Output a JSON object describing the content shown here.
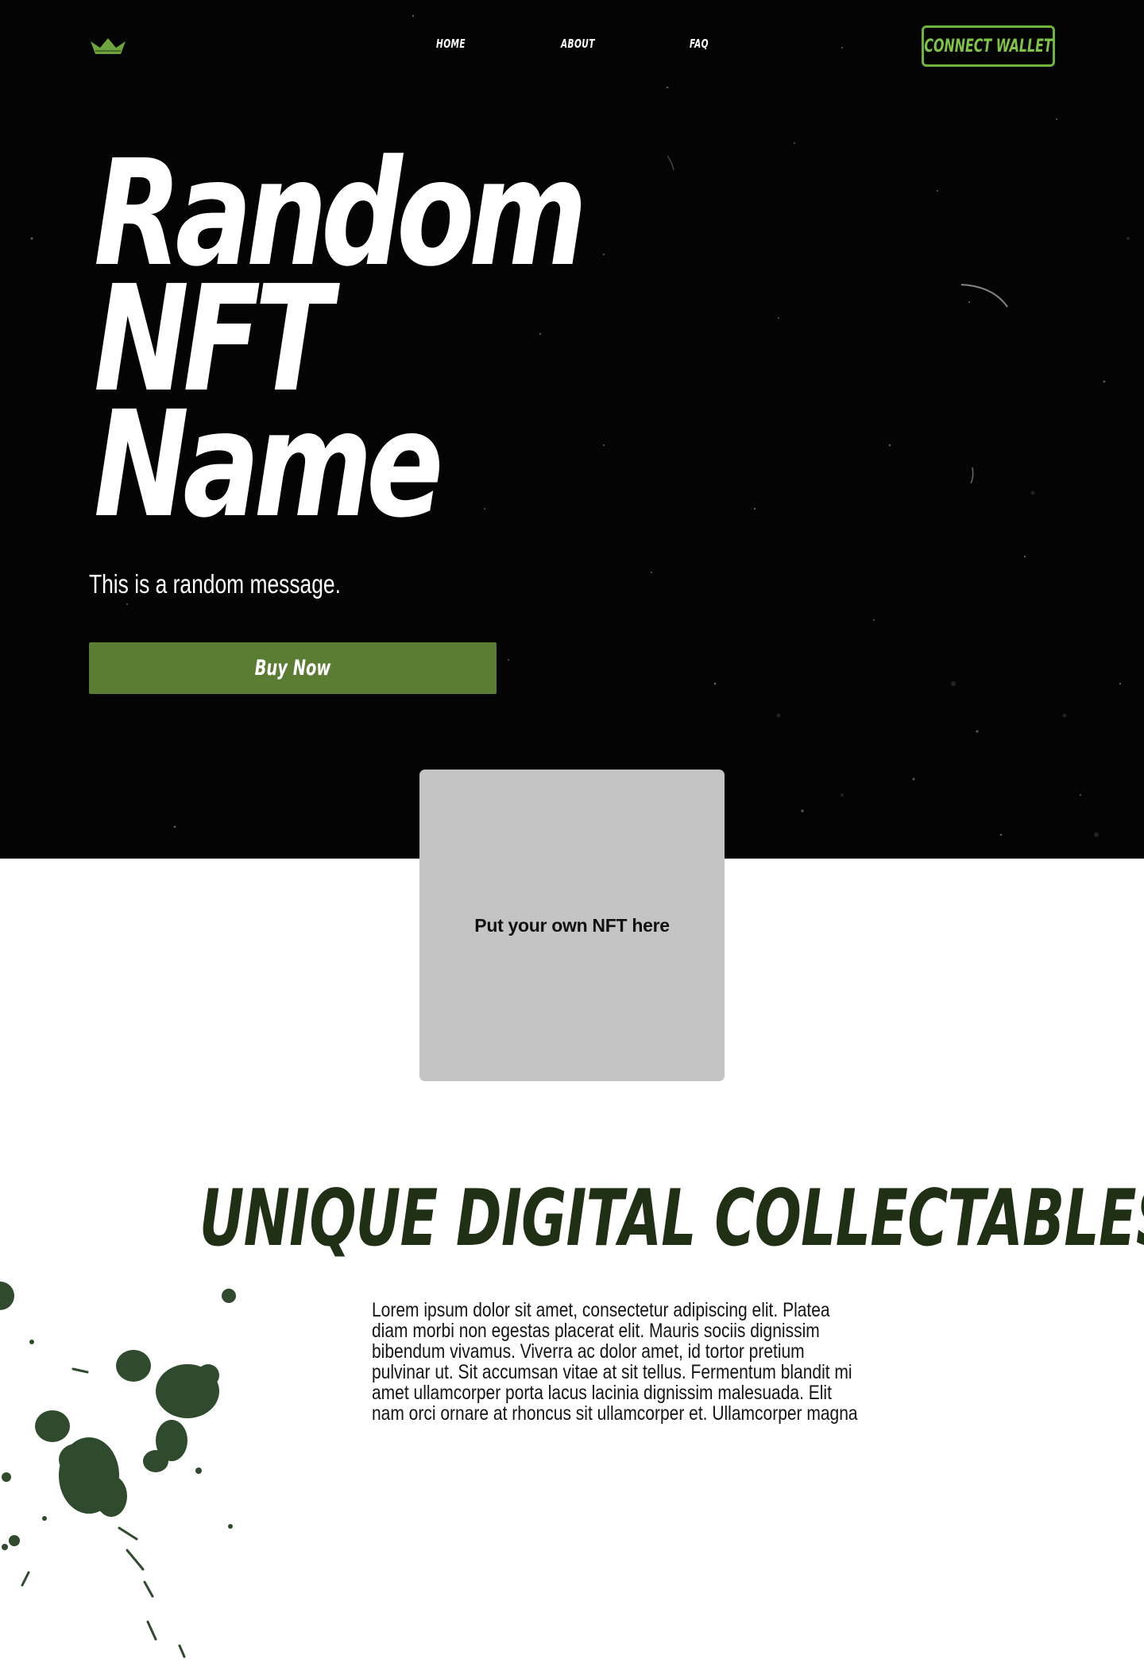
{
  "nav": {
    "logo_icon": "crown-icon",
    "links": [
      {
        "label": "HOME"
      },
      {
        "label": "ABOUT"
      },
      {
        "label": "FAQ"
      }
    ],
    "connect_label": "CONNECT WALLET"
  },
  "hero": {
    "title_lines": [
      "Random",
      "NFT",
      "Name"
    ],
    "message": "This is a random message.",
    "buy_label": "Buy Now"
  },
  "nft_placeholder": {
    "label": "Put your own NFT here"
  },
  "collectables": {
    "title": "UNIQUE DIGITAL COLLECTABLES",
    "body_lines": [
      "Lorem ipsum dolor sit amet, consectetur adipiscing elit. Platea",
      "diam morbi non egestas placerat elit. Mauris sociis dignissim",
      "bibendum vivamus. Viverra ac dolor amet, id tortor pretium",
      "pulvinar ut. Sit accumsan vitae at sit tellus. Fermentum blandit mi",
      "amet ullamcorper porta lacus lacinia dignissim malesuada. Elit",
      "nam orci ornare at rhoncus sit ullamcorper et. Ullamcorper magna"
    ]
  },
  "colors": {
    "hero_bg": "#040404",
    "accent_green": "#6cb43c",
    "buy_green": "#5b7c33",
    "title_dark_green": "#1f3015",
    "splatter_green": "#2f4a2c",
    "placeholder_gray": "#c4c4c4"
  }
}
